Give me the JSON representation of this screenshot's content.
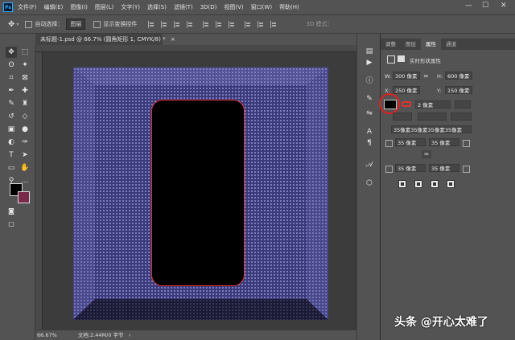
{
  "menubar": {
    "logo": "Ps",
    "items": [
      "文件(F)",
      "编辑(E)",
      "图像(I)",
      "图层(L)",
      "文字(Y)",
      "选择(S)",
      "滤镜(T)",
      "3D(D)",
      "视图(V)",
      "窗口(W)",
      "帮助(H)"
    ],
    "minimize": "—",
    "maximize": "☐",
    "close": "✕"
  },
  "optionsbar": {
    "auto_select_label": "自动选择：",
    "auto_select_value": "图层",
    "show_transform_label": "显示变换控件",
    "mode_3d_label": "3D 模式："
  },
  "document": {
    "tab_title": "未标题-1.psd @ 66.7% (圆角矩形 1, CMYK/8) *",
    "tab_close": "×",
    "zoom": "66.67%",
    "doc_info": "文档:2.44M/0 字节"
  },
  "colors": {
    "foreground": "#000000",
    "background": "#7a2a4a",
    "shape_border": "#e03333",
    "highlight_circle": "#e02020",
    "pattern": "#3a3a7a"
  },
  "tools": [
    "move-icon",
    "marquee-icon",
    "lasso-icon",
    "magic-wand-icon",
    "crop-icon",
    "frame-icon",
    "eyedropper-icon",
    "healing-icon",
    "brush-icon",
    "stamp-icon",
    "history-brush-icon",
    "eraser-icon",
    "gradient-icon",
    "blur-icon",
    "dodge-icon",
    "pen-icon",
    "type-icon",
    "path-select-icon",
    "rectangle-icon",
    "hand-icon",
    "zoom-icon",
    "more-icon"
  ],
  "panel": {
    "tabs": [
      "调整",
      "图层",
      "属性",
      "通道"
    ],
    "active_tab": "属性",
    "header": "实时形状属性",
    "w_label": "W:",
    "w_value": "300 像素",
    "h_label": "H:",
    "h_value": "600 像素",
    "x_label": "X:",
    "x_value": "250 像素",
    "y_label": "Y:",
    "y_value": "150 像素",
    "stroke_width": "2 像素",
    "corner_all": "35像素35像素35像素35像素",
    "corner_tl": "35 像素",
    "corner_tr": "35 像素",
    "corner_bl": "35 像素",
    "corner_br": "35 像素"
  },
  "watermark": "头条 @开心太难了"
}
